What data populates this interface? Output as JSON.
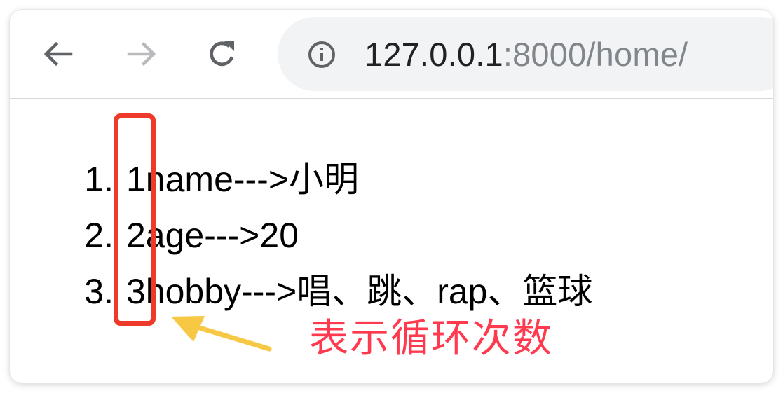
{
  "browser": {
    "nav": {
      "back_icon": "arrow-left-icon",
      "forward_icon": "arrow-right-icon",
      "reload_icon": "reload-icon"
    },
    "address_bar": {
      "info_icon": "info-icon",
      "url_host": "127.0.0.1",
      "url_path": ":8000/home/"
    }
  },
  "list": {
    "items": [
      {
        "number": "1.",
        "text": "1name--->小明"
      },
      {
        "number": "2.",
        "text": "2age--->20"
      },
      {
        "number": "3.",
        "text": "3hobby--->唱、跳、rap、篮球"
      }
    ]
  },
  "annotation": {
    "label": "表示循环次数",
    "box_color": "#ee3a2b",
    "arrow_color": "#f7c844",
    "text_color": "#ff3a4f"
  }
}
